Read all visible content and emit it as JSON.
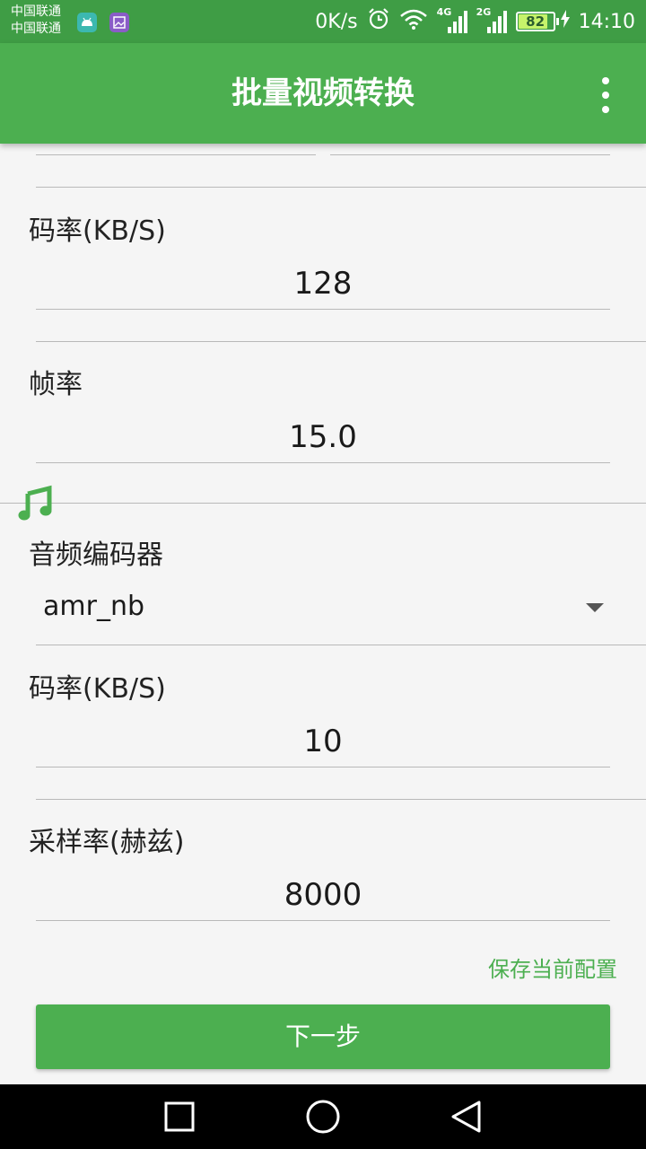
{
  "status_bar": {
    "carrier_1": "中国联通",
    "carrier_2": "中国联通",
    "net_speed": "0K/s",
    "signal_1_label": "4G",
    "signal_2_label": "2G",
    "battery": "82",
    "time": "14:10"
  },
  "app_bar": {
    "title": "批量视频转换"
  },
  "video": {
    "bitrate_label": "码率(KB/S)",
    "bitrate_value": "128",
    "framerate_label": "帧率",
    "framerate_value": "15.0"
  },
  "audio": {
    "codec_label": "音频编码器",
    "codec_value": "amr_nb",
    "bitrate_label": "码率(KB/S)",
    "bitrate_value": "10",
    "samplerate_label": "采样率(赫兹)",
    "samplerate_value": "8000"
  },
  "actions": {
    "save_config": "保存当前配置",
    "next": "下一步"
  },
  "colors": {
    "primary": "#4caf50",
    "status_bar": "#3f9d45"
  }
}
